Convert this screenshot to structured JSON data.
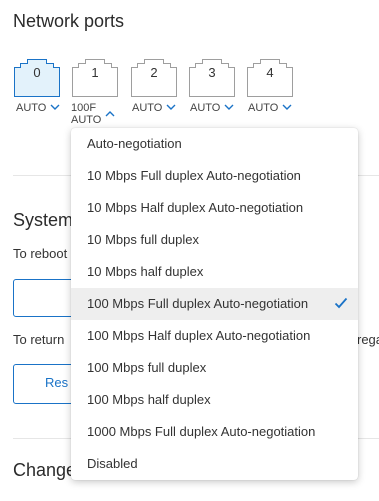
{
  "page": {
    "title": "Network ports"
  },
  "ports": [
    {
      "number": "0",
      "mode": "AUTO",
      "active": true,
      "expanded": false
    },
    {
      "number": "1",
      "mode": "100F",
      "mode2": "AUTO",
      "active": false,
      "expanded": true
    },
    {
      "number": "2",
      "mode": "AUTO",
      "active": false,
      "expanded": false
    },
    {
      "number": "3",
      "mode": "AUTO",
      "active": false,
      "expanded": false
    },
    {
      "number": "4",
      "mode": "AUTO",
      "active": false,
      "expanded": false
    }
  ],
  "system": {
    "title": "System",
    "reboot_text": "To reboot",
    "return_text": "To return",
    "return_text_tail": "rega",
    "reset_button_label": "Res"
  },
  "change": {
    "title": "Change"
  },
  "dropdown": {
    "options": [
      "Auto-negotiation",
      "10 Mbps Full duplex Auto-negotiation",
      "10 Mbps Half duplex Auto-negotiation",
      "10 Mbps full duplex",
      "10 Mbps half duplex",
      "100 Mbps Full duplex Auto-negotiation",
      "100 Mbps Half duplex Auto-negotiation",
      "100 Mbps full duplex",
      "100 Mbps half duplex",
      "1000 Mbps Full duplex Auto-negotiation",
      "Disabled"
    ],
    "selected": "100 Mbps Full duplex Auto-negotiation"
  },
  "colors": {
    "accent": "#1a73c7",
    "port_active_fill": "#e3f2fb",
    "port_active_border": "#1a73c7",
    "port_border": "#9e9e9e"
  },
  "icons": {
    "chevron": "chevron-down-icon",
    "chevron_up": "chevron-up-icon",
    "check": "check-icon",
    "port": "ethernet-port-icon"
  }
}
